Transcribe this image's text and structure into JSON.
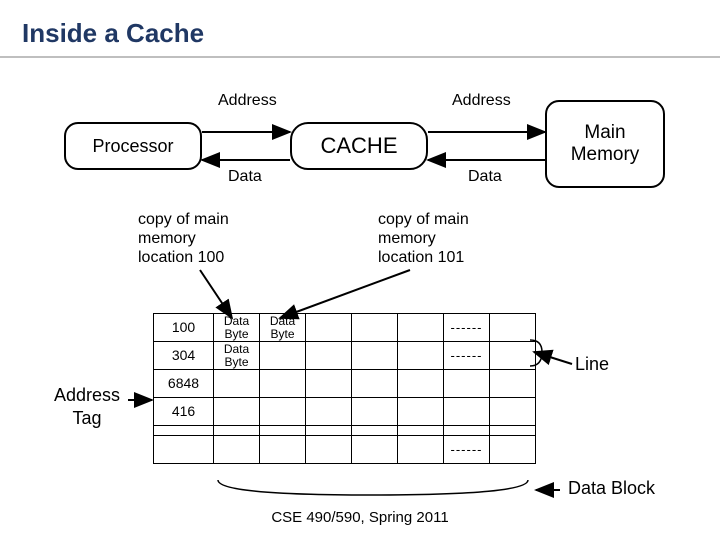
{
  "title": "Inside a Cache",
  "nodes": {
    "processor": "Processor",
    "cache": "CACHE",
    "memory": "Main\nMemory"
  },
  "bus": {
    "address_left": "Address",
    "address_right": "Address",
    "data_left": "Data",
    "data_right": "Data"
  },
  "annotations": {
    "copy100": "copy of main\nmemory\nlocation 100",
    "copy101": "copy of main\nmemory\nlocation 101",
    "address_tag": "Address\nTag",
    "line": "Line",
    "data_block": "Data Block"
  },
  "cache_table": {
    "rows": [
      {
        "addr": "100",
        "cells": [
          "Data\nByte",
          "Data\nByte",
          "",
          "",
          "",
          "------",
          ""
        ]
      },
      {
        "addr": "304",
        "cells": [
          "Data\nByte",
          "",
          "",
          "",
          "",
          "------",
          ""
        ]
      },
      {
        "addr": "6848",
        "cells": [
          "",
          "",
          "",
          "",
          "",
          "",
          ""
        ]
      },
      {
        "addr": "416",
        "cells": [
          "",
          "",
          "",
          "",
          "",
          "",
          ""
        ]
      },
      {
        "addr": "",
        "cells": [
          "",
          "",
          "",
          "",
          "",
          "",
          ""
        ],
        "thin": true
      },
      {
        "addr": "",
        "cells": [
          "",
          "",
          "",
          "",
          "",
          "------",
          ""
        ]
      }
    ]
  },
  "footer": "CSE 490/590, Spring 2011"
}
